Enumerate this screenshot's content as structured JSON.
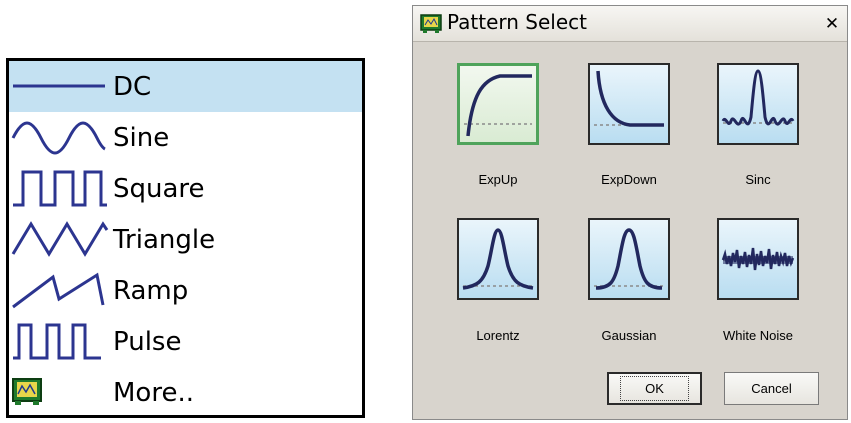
{
  "waveform_menu": {
    "items": [
      {
        "label": "DC",
        "icon": "dc-wave-icon",
        "selected": true
      },
      {
        "label": "Sine",
        "icon": "sine-wave-icon",
        "selected": false
      },
      {
        "label": "Square",
        "icon": "square-wave-icon",
        "selected": false
      },
      {
        "label": "Triangle",
        "icon": "triangle-wave-icon",
        "selected": false
      },
      {
        "label": "Ramp",
        "icon": "ramp-wave-icon",
        "selected": false
      },
      {
        "label": "Pulse",
        "icon": "pulse-wave-icon",
        "selected": false
      },
      {
        "label": "More..",
        "icon": "pattern-app-icon",
        "selected": false
      }
    ],
    "highlight_color": "#c4e1f2"
  },
  "dialog": {
    "title": "Pattern Select",
    "close_symbol": "✕",
    "patterns": [
      {
        "label": "ExpUp",
        "icon": "exp-up-icon",
        "selected": true
      },
      {
        "label": "ExpDown",
        "icon": "exp-down-icon",
        "selected": false
      },
      {
        "label": "Sinc",
        "icon": "sinc-icon",
        "selected": false
      },
      {
        "label": "Lorentz",
        "icon": "lorentz-icon",
        "selected": false
      },
      {
        "label": "Gaussian",
        "icon": "gaussian-icon",
        "selected": false
      },
      {
        "label": "White Noise",
        "icon": "white-noise-icon",
        "selected": false
      }
    ],
    "ok_label": "OK",
    "cancel_label": "Cancel"
  },
  "colors": {
    "wave_stroke": "#2c3590",
    "selected_border": "#4fa35b",
    "dialog_bg": "#d8d4cd"
  }
}
